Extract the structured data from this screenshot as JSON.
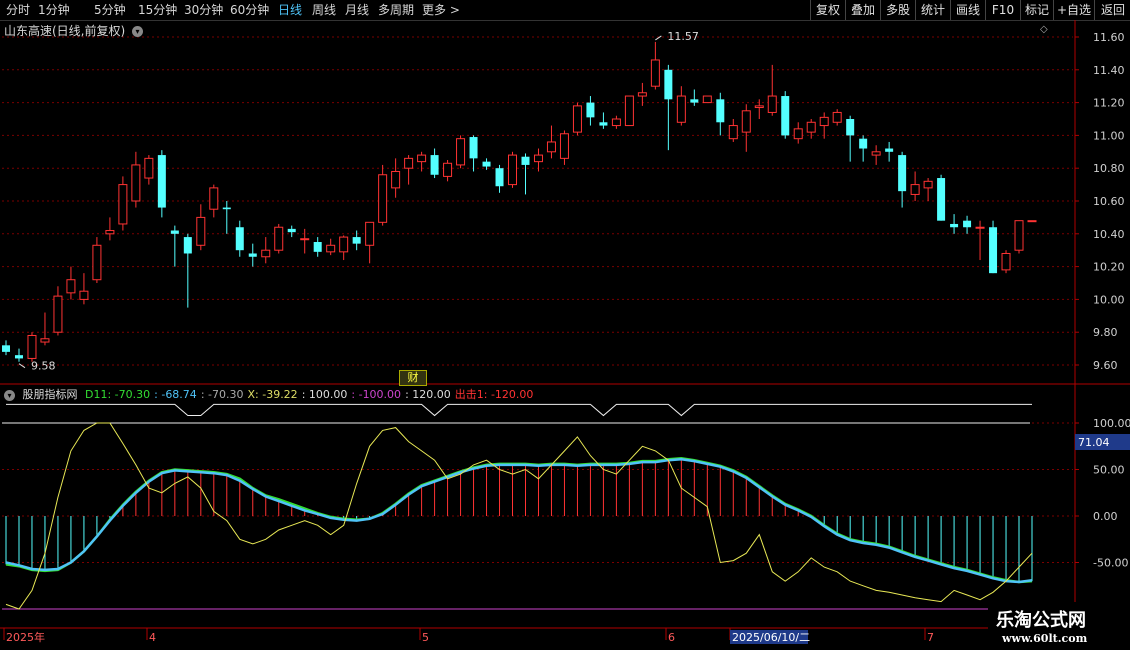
{
  "toolbar": {
    "periods": [
      "分时",
      "1分钟",
      "5分钟",
      "15分钟",
      "30分钟",
      "60分钟",
      "日线",
      "周线",
      "月线",
      "多周期",
      "更多 >"
    ],
    "active_period": "日线",
    "tools": [
      "复权",
      "叠加",
      "多股",
      "统计",
      "画线",
      "F10",
      "标记",
      "+自选",
      "返回"
    ]
  },
  "stock": {
    "name": "山东高速(日线,前复权)"
  },
  "indicator": {
    "name": "股朋指标网",
    "items": [
      {
        "text": "D11: -70.30",
        "color": "#33dd33"
      },
      {
        "text": ": -68.74",
        "color": "#4fc3f7"
      },
      {
        "text": ": -70.30",
        "color": "#aaaaaa"
      },
      {
        "text": "X: -39.22",
        "color": "#dddd66"
      },
      {
        "text": ": 100.00",
        "color": "#dddddd"
      },
      {
        "text": ": -100.00",
        "color": "#cc44cc"
      },
      {
        "text": ": 120.00",
        "color": "#dddddd"
      },
      {
        "text": "出击1: -120.00",
        "color": "#ff3333"
      }
    ],
    "current_value_badge": "71.04"
  },
  "cai_label": "财",
  "watermark": {
    "line1": "乐淘公式网",
    "line2": "www.60lt.com"
  },
  "colors": {
    "up": "#ff3333",
    "down": "#54ffff",
    "grid": "#7a0000",
    "axis": "#b00000"
  },
  "chart_data": [
    {
      "type": "candlestick",
      "title": "山东高速(日线,前复权)",
      "ylim": [
        9.5,
        11.7
      ],
      "yticks": [
        "11.60",
        "11.40",
        "11.20",
        "11.00",
        "10.80",
        "10.60",
        "10.40",
        "10.20",
        "10.00",
        "9.80",
        "9.60"
      ],
      "annotations": [
        {
          "label": "11.57",
          "kind": "high"
        },
        {
          "label": "9.58",
          "kind": "low"
        }
      ],
      "ohlc": [
        [
          9.72,
          9.75,
          9.66,
          9.68
        ],
        [
          9.66,
          9.7,
          9.62,
          9.64
        ],
        [
          9.64,
          9.8,
          9.62,
          9.78
        ],
        [
          9.74,
          9.92,
          9.72,
          9.76
        ],
        [
          9.8,
          10.08,
          9.78,
          10.02
        ],
        [
          10.04,
          10.2,
          10.0,
          10.12
        ],
        [
          10.0,
          10.16,
          9.97,
          10.05
        ],
        [
          10.12,
          10.38,
          10.1,
          10.33
        ],
        [
          10.4,
          10.5,
          10.36,
          10.42
        ],
        [
          10.46,
          10.75,
          10.42,
          10.7
        ],
        [
          10.6,
          10.9,
          10.56,
          10.82
        ],
        [
          10.74,
          10.88,
          10.7,
          10.86
        ],
        [
          10.88,
          10.91,
          10.5,
          10.56
        ],
        [
          10.42,
          10.45,
          10.2,
          10.4
        ],
        [
          10.38,
          10.4,
          9.95,
          10.28
        ],
        [
          10.33,
          10.58,
          10.3,
          10.5
        ],
        [
          10.55,
          10.7,
          10.5,
          10.68
        ],
        [
          10.56,
          10.6,
          10.4,
          10.55
        ],
        [
          10.44,
          10.48,
          10.26,
          10.3
        ],
        [
          10.28,
          10.34,
          10.2,
          10.26
        ],
        [
          10.26,
          10.38,
          10.22,
          10.3
        ],
        [
          10.3,
          10.46,
          10.28,
          10.44
        ],
        [
          10.43,
          10.45,
          10.38,
          10.41
        ],
        [
          10.37,
          10.43,
          10.28,
          10.37
        ],
        [
          10.35,
          10.38,
          10.26,
          10.29
        ],
        [
          10.29,
          10.37,
          10.27,
          10.33
        ],
        [
          10.29,
          10.39,
          10.24,
          10.38
        ],
        [
          10.38,
          10.42,
          10.3,
          10.34
        ],
        [
          10.33,
          10.42,
          10.22,
          10.47
        ],
        [
          10.47,
          10.82,
          10.45,
          10.76
        ],
        [
          10.68,
          10.86,
          10.62,
          10.78
        ],
        [
          10.8,
          10.88,
          10.7,
          10.86
        ],
        [
          10.84,
          10.9,
          10.78,
          10.88
        ],
        [
          10.88,
          10.92,
          10.74,
          10.76
        ],
        [
          10.75,
          10.85,
          10.72,
          10.83
        ],
        [
          10.82,
          11.0,
          10.8,
          10.98
        ],
        [
          10.99,
          11.0,
          10.78,
          10.86
        ],
        [
          10.84,
          10.86,
          10.79,
          10.81
        ],
        [
          10.8,
          10.82,
          10.65,
          10.69
        ],
        [
          10.7,
          10.9,
          10.68,
          10.88
        ],
        [
          10.87,
          10.89,
          10.64,
          10.82
        ],
        [
          10.84,
          10.92,
          10.78,
          10.88
        ],
        [
          10.9,
          11.06,
          10.86,
          10.96
        ],
        [
          10.86,
          11.03,
          10.82,
          11.01
        ],
        [
          11.02,
          11.2,
          11.0,
          11.18
        ],
        [
          11.2,
          11.24,
          11.06,
          11.11
        ],
        [
          11.08,
          11.14,
          11.04,
          11.06
        ],
        [
          11.06,
          11.12,
          11.04,
          11.1
        ],
        [
          11.06,
          11.16,
          11.06,
          11.24
        ],
        [
          11.24,
          11.32,
          11.18,
          11.26
        ],
        [
          11.3,
          11.57,
          11.28,
          11.46
        ],
        [
          11.4,
          11.43,
          10.91,
          11.22
        ],
        [
          11.08,
          11.3,
          11.06,
          11.24
        ],
        [
          11.22,
          11.28,
          11.18,
          11.2
        ],
        [
          11.2,
          11.24,
          11.2,
          11.24
        ],
        [
          11.22,
          11.26,
          11.0,
          11.08
        ],
        [
          10.98,
          11.1,
          10.96,
          11.06
        ],
        [
          11.02,
          11.19,
          10.9,
          11.15
        ],
        [
          11.17,
          11.22,
          11.1,
          11.18
        ],
        [
          11.14,
          11.43,
          11.12,
          11.24
        ],
        [
          11.24,
          11.27,
          10.98,
          11.0
        ],
        [
          10.98,
          11.08,
          10.95,
          11.04
        ],
        [
          11.02,
          11.1,
          10.98,
          11.08
        ],
        [
          11.06,
          11.14,
          10.98,
          11.11
        ],
        [
          11.08,
          11.16,
          11.06,
          11.14
        ],
        [
          11.1,
          11.12,
          10.84,
          11.0
        ],
        [
          10.98,
          11.0,
          10.84,
          10.92
        ],
        [
          10.88,
          10.94,
          10.82,
          10.9
        ],
        [
          10.92,
          10.96,
          10.84,
          10.9
        ],
        [
          10.88,
          10.9,
          10.56,
          10.66
        ],
        [
          10.64,
          10.78,
          10.6,
          10.7
        ],
        [
          10.68,
          10.74,
          10.6,
          10.72
        ],
        [
          10.74,
          10.76,
          10.48,
          10.48
        ],
        [
          10.46,
          10.52,
          10.4,
          10.44
        ],
        [
          10.48,
          10.51,
          10.4,
          10.44
        ],
        [
          10.44,
          10.48,
          10.24,
          10.44
        ],
        [
          10.44,
          10.48,
          10.16,
          10.16
        ],
        [
          10.18,
          10.3,
          10.16,
          10.28
        ],
        [
          10.3,
          10.48,
          10.28,
          10.48
        ],
        [
          10.48,
          10.48,
          10.48,
          10.48
        ]
      ]
    },
    {
      "type": "line",
      "title": "股朋指标网",
      "ylim": [
        -120,
        120
      ],
      "yticks": [
        "100.00",
        "50.00",
        "0.00",
        "-50.00"
      ],
      "xlabels": [
        "2025年",
        "4",
        "5",
        "6",
        "2025/06/10/二",
        "7"
      ],
      "series": [
        {
          "name": "D11",
          "color": "#33dd33",
          "values": [
            -52,
            -54,
            -58,
            -59,
            -58,
            -50,
            -38,
            -22,
            -4,
            12,
            26,
            38,
            47,
            50,
            49,
            48,
            47,
            45,
            40,
            30,
            22,
            18,
            13,
            8,
            3,
            -1,
            -3,
            -4,
            -3,
            3,
            13,
            24,
            33,
            38,
            43,
            48,
            52,
            55,
            56,
            56,
            56,
            55,
            56,
            56,
            55,
            56,
            56,
            56,
            57,
            59,
            59,
            61,
            62,
            60,
            57,
            54,
            49,
            42,
            32,
            22,
            13,
            7,
            0,
            -10,
            -19,
            -25,
            -28,
            -30,
            -33,
            -38,
            -43,
            -47,
            -51,
            -55,
            -58,
            -62,
            -66,
            -69,
            -71,
            -70
          ]
        },
        {
          "name": "",
          "color": "#4fc3f7",
          "values": [
            -50,
            -53,
            -57,
            -58,
            -57,
            -50,
            -38,
            -22,
            -5,
            11,
            25,
            37,
            46,
            49,
            48,
            47,
            46,
            44,
            38,
            29,
            21,
            16,
            11,
            6,
            2,
            -2,
            -4,
            -5,
            -3,
            2,
            12,
            23,
            32,
            37,
            42,
            47,
            51,
            54,
            55,
            55,
            55,
            54,
            55,
            55,
            54,
            55,
            55,
            55,
            56,
            58,
            58,
            60,
            61,
            59,
            56,
            53,
            48,
            41,
            31,
            21,
            12,
            6,
            -1,
            -11,
            -20,
            -26,
            -29,
            -31,
            -34,
            -39,
            -44,
            -48,
            -52,
            -56,
            -59,
            -63,
            -67,
            -70,
            -71,
            -69
          ]
        },
        {
          "name": "X",
          "color": "#e8e855",
          "values": [
            -95,
            -100,
            -80,
            -40,
            20,
            70,
            92,
            100,
            100,
            78,
            55,
            30,
            25,
            35,
            42,
            30,
            5,
            -5,
            -25,
            -30,
            -25,
            -15,
            -10,
            -5,
            -10,
            -20,
            -10,
            35,
            75,
            92,
            95,
            80,
            70,
            60,
            40,
            45,
            55,
            60,
            50,
            45,
            50,
            40,
            55,
            70,
            85,
            65,
            50,
            45,
            60,
            75,
            70,
            60,
            30,
            20,
            10,
            -50,
            -48,
            -40,
            -20,
            -60,
            -70,
            -60,
            -45,
            -55,
            -60,
            -70,
            -75,
            -80,
            -82,
            -85,
            -88,
            -90,
            -92,
            -80,
            -85,
            -90,
            -82,
            -70,
            -55,
            -40
          ]
        }
      ],
      "reference_lines": [
        100,
        -100,
        120
      ]
    }
  ]
}
